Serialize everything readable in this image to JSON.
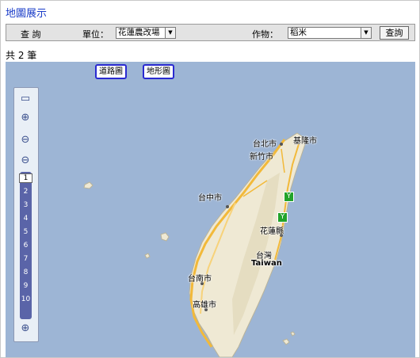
{
  "page_title": "地圖展示",
  "filter": {
    "query_label": "查 詢",
    "unit_label": "單位：",
    "unit_value": "花蓮農改場",
    "crop_label": "作物：",
    "crop_value": "稻米",
    "search_button": "查詢"
  },
  "result_count": "共 2 筆",
  "map": {
    "type_buttons": [
      "道路圖",
      "地形圖"
    ],
    "zoom_levels": [
      "1",
      "2",
      "3",
      "4",
      "5",
      "6",
      "7",
      "8",
      "9",
      "10"
    ],
    "active_zoom": "1",
    "cities": {
      "keelung": "基隆市",
      "taipei": "台北市",
      "hsinchu": "新竹市",
      "taichung": "台中市",
      "hualien": "花蓮縣",
      "taiwan_zh": "台灣",
      "taiwan_en": "Taiwan",
      "tainan": "台南市",
      "kaohsiung": "高雄市"
    },
    "marker_icon": "plant-marker-icon"
  }
}
